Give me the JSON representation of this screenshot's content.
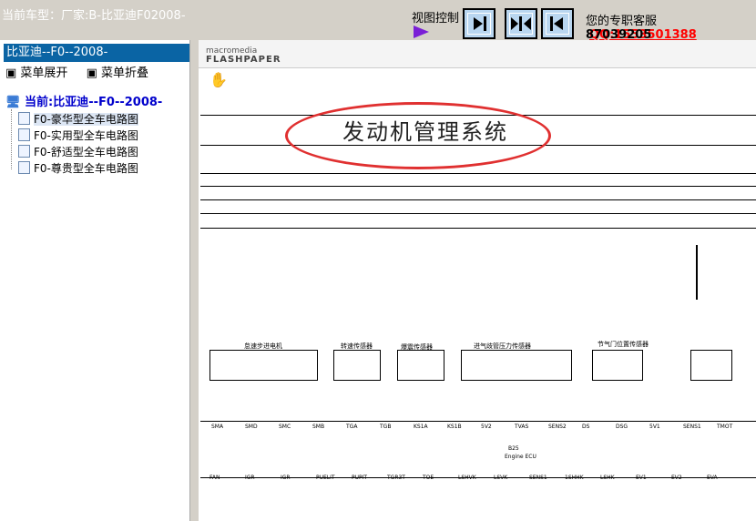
{
  "header": {
    "car_label": "当前车型：厂家:B-比亚迪F02008-",
    "view_control": "视图控制",
    "support_text": "您的专职客服",
    "support_qq": "QQ:1553501388",
    "support_qq2": "87039205"
  },
  "sidebar": {
    "title": "比亚迪--F0--2008-",
    "expand": "菜单展开",
    "collapse": "菜单折叠",
    "root": "当前:比亚迪--F0--2008-",
    "items": [
      {
        "label": "F0-豪华型全车电路图"
      },
      {
        "label": "F0-实用型全车电路图"
      },
      {
        "label": "F0-舒适型全车电路图"
      },
      {
        "label": "F0-尊贵型全车电路图"
      }
    ]
  },
  "viewer": {
    "logo_top": "macromedia",
    "logo_bottom": "FLASHPAPER",
    "doc_title": "发动机管理系统",
    "components": [
      {
        "label": "怠速步进电机"
      },
      {
        "label": "转速传感器"
      },
      {
        "label": "爆震传感器"
      },
      {
        "label": "进气歧管压力传感器"
      },
      {
        "label": "节气门位置传感器"
      }
    ],
    "ecu_label": "B25",
    "ecu_sub": "Engine ECU",
    "pins_row1": [
      "SMA",
      "SMD",
      "SMC",
      "SMB",
      "TGA",
      "TGB",
      "KS1A",
      "KS1B",
      "5V2",
      "TVAS",
      "SENS2",
      "DS",
      "DSG",
      "5V1",
      "SENS1",
      "TMOT"
    ],
    "pins_row2": [
      "FAN",
      "IGR",
      "IGR",
      "PUELIT",
      "PUPIT",
      "TGR3T",
      "TOE",
      "LSHVK",
      "LSVK",
      "SENS1",
      "1SHHK",
      "LSHK",
      "EV1",
      "EV2",
      "EVA"
    ]
  },
  "colors": {
    "accent": "#0a64a4",
    "qq": "#ff0000",
    "ellipse": "#e03030"
  }
}
